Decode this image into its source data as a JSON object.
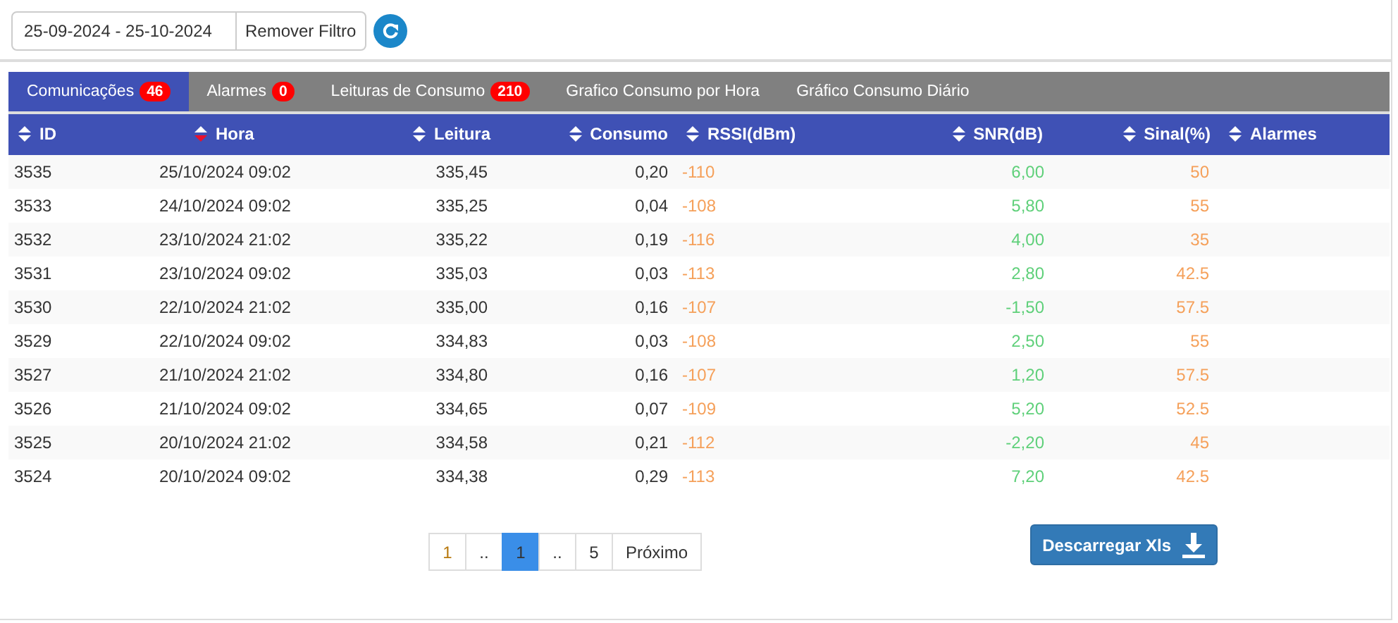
{
  "filter": {
    "date_range": "25-09-2024 - 25-10-2024",
    "remove_label": "Remover Filtro"
  },
  "tabs": [
    {
      "label": "Comunicações",
      "badge": "46",
      "selected": true
    },
    {
      "label": "Alarmes",
      "badge": "0",
      "selected": false
    },
    {
      "label": "Leituras de Consumo",
      "badge": "210",
      "selected": false
    },
    {
      "label": "Grafico Consumo por Hora",
      "selected": false
    },
    {
      "label": "Gráfico Consumo Diário",
      "selected": false
    }
  ],
  "table": {
    "columns": [
      {
        "label": "ID",
        "sorted": false
      },
      {
        "label": "Hora",
        "sorted": true
      },
      {
        "label": "Leitura",
        "sorted": false
      },
      {
        "label": "Consumo",
        "sorted": false
      },
      {
        "label": "RSSI(dBm)",
        "sorted": false,
        "color": "#f5a05a"
      },
      {
        "label": "SNR(dB)",
        "sorted": false,
        "color": "#5fd07a"
      },
      {
        "label": "Sinal(%)",
        "sorted": false,
        "color": "#f5a05a"
      },
      {
        "label": "Alarmes",
        "sorted": false
      }
    ],
    "rows": [
      [
        "3535",
        "25/10/2024 09:02",
        "335,45",
        "0,20",
        "-110",
        "6,00",
        "50"
      ],
      [
        "3533",
        "24/10/2024 09:02",
        "335,25",
        "0,04",
        "-108",
        "5,80",
        "55"
      ],
      [
        "3532",
        "23/10/2024 21:02",
        "335,22",
        "0,19",
        "-116",
        "4,00",
        "35"
      ],
      [
        "3531",
        "23/10/2024 09:02",
        "335,03",
        "0,03",
        "-113",
        "2,80",
        "42.5"
      ],
      [
        "3530",
        "22/10/2024 21:02",
        "335,00",
        "0,16",
        "-107",
        "-1,50",
        "57.5"
      ],
      [
        "3529",
        "22/10/2024 09:02",
        "334,83",
        "0,03",
        "-108",
        "2,50",
        "55"
      ],
      [
        "3527",
        "21/10/2024 21:02",
        "334,80",
        "0,16",
        "-107",
        "1,20",
        "57.5"
      ],
      [
        "3526",
        "21/10/2024 09:02",
        "334,65",
        "0,07",
        "-109",
        "5,20",
        "52.5"
      ],
      [
        "3525",
        "20/10/2024 21:02",
        "334,58",
        "0,21",
        "-112",
        "-2,20",
        "45"
      ],
      [
        "3524",
        "20/10/2024 09:02",
        "334,38",
        "0,29",
        "-113",
        "7,20",
        "42.5"
      ]
    ]
  },
  "pagination": [
    {
      "label": "1",
      "kind": "first",
      "selected": false
    },
    {
      "label": "..",
      "kind": "gap",
      "selected": false
    },
    {
      "label": "1",
      "kind": "page",
      "selected": true
    },
    {
      "label": "..",
      "kind": "gap",
      "selected": false
    },
    {
      "label": "5",
      "kind": "page",
      "selected": false
    },
    {
      "label": "Próximo",
      "kind": "next",
      "selected": false
    }
  ],
  "download_label": "Descarregar Xls"
}
